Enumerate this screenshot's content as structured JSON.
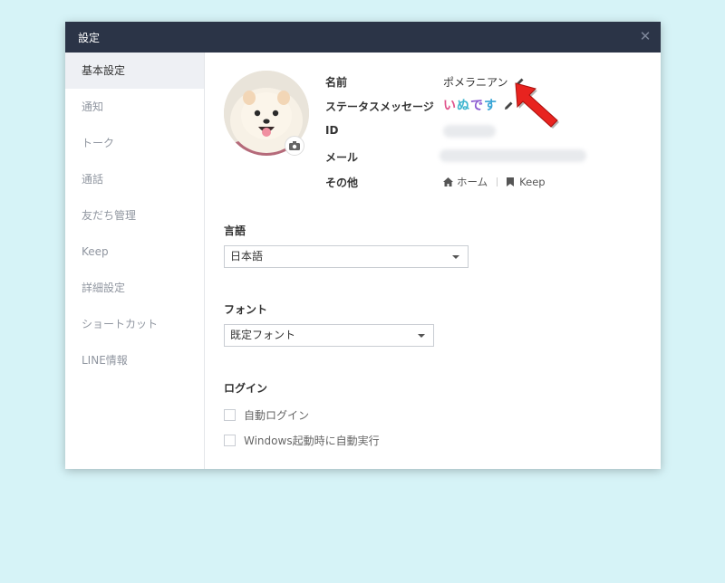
{
  "window": {
    "title": "設定"
  },
  "sidebar": {
    "items": [
      {
        "label": "基本設定",
        "active": true
      },
      {
        "label": "通知"
      },
      {
        "label": "トーク"
      },
      {
        "label": "通話"
      },
      {
        "label": "友だち管理"
      },
      {
        "label": "Keep"
      },
      {
        "label": "詳細設定"
      },
      {
        "label": "ショートカット"
      },
      {
        "label": "LINE情報"
      }
    ]
  },
  "profile": {
    "labels": {
      "name": "名前",
      "status": "ステータスメッセージ",
      "id": "ID",
      "mail": "メール",
      "other": "その他"
    },
    "name_value": "ポメラニアン",
    "status_value": "いぬです",
    "links": {
      "home": "ホーム",
      "keep": "Keep"
    }
  },
  "language": {
    "title": "言語",
    "selected": "日本語"
  },
  "font": {
    "title": "フォント",
    "selected": "既定フォント"
  },
  "login": {
    "title": "ログイン",
    "options": [
      {
        "label": "自動ログイン",
        "checked": false
      },
      {
        "label": "Windows起動時に自動実行",
        "checked": false
      }
    ]
  },
  "colors": {
    "titlebar": "#2b3447",
    "background": "#d6f3f7",
    "arrow": "#e8231f"
  }
}
